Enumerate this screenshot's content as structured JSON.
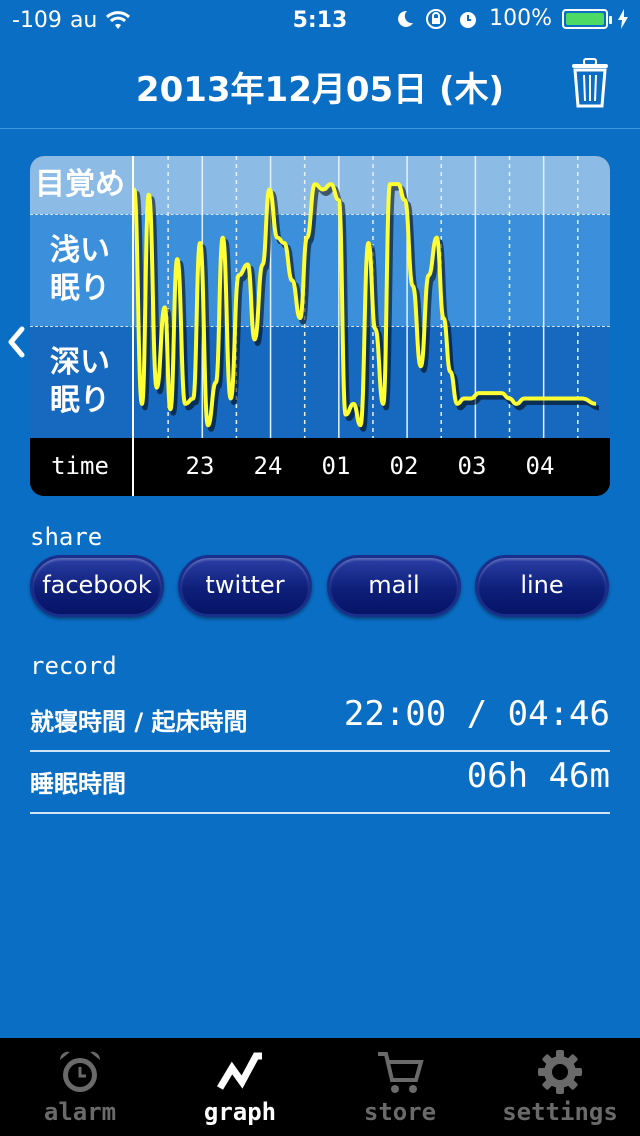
{
  "status_bar": {
    "signal": "-109",
    "carrier": "au",
    "time": "5:13",
    "battery": "100%"
  },
  "header": {
    "date": "2013年12月05日 (木)",
    "trash_icon": "trash-icon"
  },
  "chart": {
    "bands": [
      "目覚め",
      "浅い\n眠り",
      "深い\n眠り"
    ],
    "time_label": "time",
    "hours": [
      "23",
      "24",
      "01",
      "02",
      "03",
      "04"
    ],
    "line_color": "#ffff33",
    "wake_color": "#8cbce6",
    "light_color": "#3c8fdb",
    "deep_color": "#1769bf"
  },
  "chart_data": {
    "type": "line",
    "title": "",
    "xlabel": "time",
    "ylabel": "",
    "y_categories": [
      "深い眠り",
      "浅い眠り",
      "目覚め"
    ],
    "ylim": [
      0,
      2.5
    ],
    "xlim": [
      "22:00",
      "04:46"
    ],
    "series": [
      {
        "x": [
          "22:00",
          "22:07",
          "22:13",
          "22:20",
          "22:27",
          "22:32",
          "22:38",
          "22:45",
          "22:52",
          "22:58",
          "23:05",
          "23:12",
          "23:18",
          "23:25",
          "23:32",
          "23:40",
          "23:46",
          "23:53",
          "23:59",
          "00:06",
          "00:12",
          "00:19",
          "00:26",
          "00:32",
          "00:39",
          "00:46",
          "00:53",
          "01:00",
          "01:06",
          "01:13",
          "01:19",
          "01:26",
          "01:32",
          "01:39",
          "01:45",
          "01:52",
          "01:58",
          "02:05",
          "02:12",
          "02:19",
          "02:26",
          "02:32",
          "02:38",
          "02:44",
          "02:50",
          "02:56",
          "03:03",
          "03:10",
          "03:16",
          "03:23",
          "03:30",
          "03:36",
          "03:43",
          "03:50",
          "04:00",
          "04:10",
          "04:22",
          "04:34",
          "04:46"
        ],
        "values": [
          2.3,
          0.3,
          2.25,
          0.45,
          1.2,
          0.25,
          1.65,
          0.3,
          0.35,
          1.8,
          0.1,
          0.5,
          1.85,
          0.35,
          1.5,
          1.6,
          0.9,
          1.6,
          2.3,
          1.85,
          1.8,
          1.45,
          1.1,
          1.85,
          2.35,
          2.3,
          2.35,
          2.2,
          0.2,
          0.3,
          0.1,
          1.8,
          1.0,
          0.3,
          2.35,
          2.35,
          2.2,
          1.4,
          0.65,
          1.5,
          1.85,
          1.1,
          0.6,
          0.3,
          0.35,
          0.35,
          0.4,
          0.4,
          0.4,
          0.4,
          0.35,
          0.3,
          0.35,
          0.35,
          0.35,
          0.35,
          0.35,
          0.35,
          0.3
        ]
      }
    ]
  },
  "share": {
    "label": "share",
    "buttons": [
      "facebook",
      "twitter",
      "mail",
      "line"
    ]
  },
  "record": {
    "label": "record",
    "rows": [
      {
        "key": "就寝時間 / 起床時間",
        "value": "22:00 / 04:46"
      },
      {
        "key": "睡眠時間",
        "value": "06h 46m"
      }
    ]
  },
  "tabs": [
    {
      "label": "alarm",
      "icon": "alarm-clock-icon",
      "active": false
    },
    {
      "label": "graph",
      "icon": "graph-icon",
      "active": true
    },
    {
      "label": "store",
      "icon": "cart-icon",
      "active": false
    },
    {
      "label": "settings",
      "icon": "gear-icon",
      "active": false
    }
  ]
}
